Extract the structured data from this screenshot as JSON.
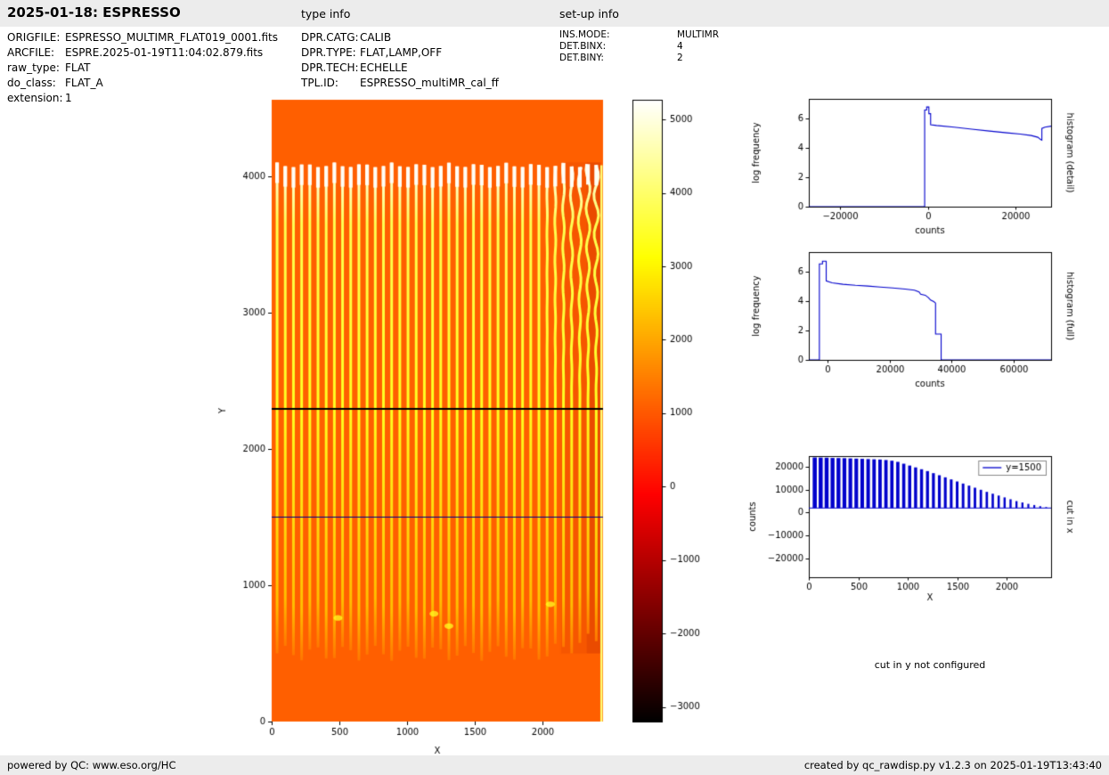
{
  "header": {
    "title": "2025-01-18: ESPRESSO",
    "type_info_label": "type info",
    "setup_info_label": "set-up info"
  },
  "file_info": {
    "rows": [
      {
        "label": "ORIGFILE:",
        "value": "ESPRESSO_MULTIMR_FLAT019_0001.fits"
      },
      {
        "label": "ARCFILE:",
        "value": "ESPRE.2025-01-19T11:04:02.879.fits"
      },
      {
        "label": "raw_type:",
        "value": "FLAT"
      },
      {
        "label": "do_class:",
        "value": "FLAT_A"
      },
      {
        "label": "extension:",
        "value": "1"
      }
    ]
  },
  "type_info": {
    "rows": [
      {
        "label": "DPR.CATG:",
        "value": "CALIB"
      },
      {
        "label": "DPR.TYPE:",
        "value": "FLAT,LAMP,OFF"
      },
      {
        "label": "DPR.TECH:",
        "value": "ECHELLE"
      },
      {
        "label": "TPL.ID:",
        "value": "ESPRESSO_multiMR_cal_ff"
      }
    ]
  },
  "setup_info": {
    "rows": [
      {
        "label": "INS.MODE:",
        "value": "MULTIMR"
      },
      {
        "label": "DET.BINX:",
        "value": "4"
      },
      {
        "label": "DET.BINY:",
        "value": "2"
      }
    ]
  },
  "cut_y_note": "cut in y not configured",
  "footer": {
    "left": "powered by QC: www.eso.org/HC",
    "right": "created by qc_rawdisp.py v1.2.3 on 2025-01-19T13:43:40"
  },
  "colors": {
    "plot_line": "#0000cc",
    "cut_line": "#00008b",
    "bar_bg": "#ececec"
  },
  "chart_data": [
    {
      "id": "raw_image",
      "type": "heatmap",
      "xlabel": "X",
      "ylabel": "Y",
      "xlim": [
        0,
        2450
      ],
      "ylim": [
        0,
        4560
      ],
      "xticks": [
        0,
        500,
        1000,
        1500,
        2000
      ],
      "yticks": [
        0,
        1000,
        2000,
        3000,
        4000
      ],
      "colormap": "hot",
      "background_value": 1100,
      "stripes": {
        "count": 40,
        "x_first": 40,
        "x_step": 60.5,
        "y_bottom": 500,
        "y_top": 4100,
        "value": 3400,
        "tip_value": 5200
      },
      "black_line_y": 2300,
      "cut_line_y": 1500,
      "cut_line_color": "#00008b",
      "edge_line": {
        "x": 2438,
        "value": 4100,
        "y0": 0,
        "y1": 4080
      },
      "dark_bands": [
        {
          "x0": 2140,
          "x1": 2430,
          "y0": 500,
          "y1": 4100,
          "alpha": 0.12
        },
        {
          "x0": 2330,
          "x1": 2434,
          "y0": 500,
          "y1": 4100,
          "alpha": 0.18
        }
      ],
      "blobs": [
        [
          1200,
          790
        ],
        [
          1310,
          700
        ],
        [
          490,
          760
        ],
        [
          2060,
          860
        ]
      ],
      "colorbar": {
        "vmin": -3200,
        "vmax": 5270,
        "ticks": [
          5000,
          4000,
          3000,
          2000,
          1000,
          0,
          -1000,
          -2000,
          -3000
        ]
      }
    },
    {
      "id": "histogram_detail",
      "type": "line",
      "side_label": "histogram (detail)",
      "xlabel": "counts",
      "ylabel": "log frequency",
      "xlim": [
        -27000,
        28000
      ],
      "ylim": [
        0,
        7.3
      ],
      "xticks": [
        -20000,
        0,
        20000
      ],
      "yticks": [
        0,
        2,
        4,
        6
      ],
      "color": "#0000cc",
      "points": [
        [
          -27000,
          0
        ],
        [
          -700,
          0
        ],
        [
          -700,
          6.55
        ],
        [
          -250,
          6.55
        ],
        [
          -250,
          6.75
        ],
        [
          250,
          6.75
        ],
        [
          250,
          6.3
        ],
        [
          650,
          6.3
        ],
        [
          650,
          5.55
        ],
        [
          2000,
          5.5
        ],
        [
          6000,
          5.38
        ],
        [
          10000,
          5.25
        ],
        [
          14000,
          5.12
        ],
        [
          18000,
          5.0
        ],
        [
          21000,
          4.92
        ],
        [
          23500,
          4.82
        ],
        [
          25000,
          4.7
        ],
        [
          25600,
          4.55
        ],
        [
          25900,
          4.5
        ],
        [
          25900,
          5.3
        ],
        [
          26600,
          5.38
        ],
        [
          28000,
          5.45
        ]
      ]
    },
    {
      "id": "histogram_full",
      "type": "line",
      "side_label": "histogram (full)",
      "xlabel": "counts",
      "ylabel": "log frequency",
      "xlim": [
        -6000,
        72000
      ],
      "ylim": [
        0,
        7.3
      ],
      "xticks": [
        0,
        20000,
        40000,
        60000
      ],
      "yticks": [
        0,
        2,
        4,
        6
      ],
      "color": "#0000cc",
      "points": [
        [
          -6000,
          0
        ],
        [
          -2600,
          0
        ],
        [
          -2600,
          6.5
        ],
        [
          -1600,
          6.5
        ],
        [
          -1600,
          6.68
        ],
        [
          -400,
          6.68
        ],
        [
          -400,
          5.35
        ],
        [
          1500,
          5.22
        ],
        [
          5000,
          5.12
        ],
        [
          9000,
          5.05
        ],
        [
          13000,
          5.0
        ],
        [
          17000,
          4.93
        ],
        [
          21000,
          4.87
        ],
        [
          25000,
          4.8
        ],
        [
          28000,
          4.72
        ],
        [
          29500,
          4.6
        ],
        [
          30000,
          4.45
        ],
        [
          31500,
          4.38
        ],
        [
          32500,
          4.22
        ],
        [
          33200,
          4.05
        ],
        [
          34200,
          3.95
        ],
        [
          34800,
          3.85
        ],
        [
          34800,
          1.75
        ],
        [
          36600,
          1.75
        ],
        [
          36600,
          0
        ],
        [
          72000,
          0
        ]
      ]
    },
    {
      "id": "cut_in_x",
      "type": "line",
      "side_label": "cut in x",
      "legend_label": "y=1500",
      "xlabel": "X",
      "ylabel": "counts",
      "xlim": [
        0,
        2450
      ],
      "ylim": [
        -28000,
        24500
      ],
      "xticks": [
        0,
        500,
        1000,
        1500,
        2000
      ],
      "yticks": [
        -20000,
        -10000,
        0,
        10000,
        20000
      ],
      "color": "#0000cc",
      "baseline": 2000,
      "spikes": [
        [
          60,
          23900
        ],
        [
          120,
          23850
        ],
        [
          180,
          23800
        ],
        [
          240,
          23700
        ],
        [
          300,
          23650
        ],
        [
          360,
          23600
        ],
        [
          420,
          23500
        ],
        [
          480,
          23400
        ],
        [
          540,
          23300
        ],
        [
          600,
          23200
        ],
        [
          660,
          23100
        ],
        [
          720,
          23000
        ],
        [
          780,
          22800
        ],
        [
          840,
          22500
        ],
        [
          900,
          22000
        ],
        [
          960,
          21200
        ],
        [
          1020,
          20400
        ],
        [
          1080,
          19600
        ],
        [
          1140,
          18800
        ],
        [
          1200,
          18000
        ],
        [
          1260,
          17100
        ],
        [
          1320,
          16200
        ],
        [
          1380,
          15300
        ],
        [
          1440,
          14400
        ],
        [
          1500,
          13500
        ],
        [
          1560,
          12600
        ],
        [
          1620,
          11700
        ],
        [
          1680,
          10800
        ],
        [
          1740,
          9900
        ],
        [
          1800,
          9000
        ],
        [
          1860,
          8200
        ],
        [
          1920,
          7400
        ],
        [
          1980,
          6600
        ],
        [
          2040,
          5800
        ],
        [
          2100,
          5000
        ],
        [
          2160,
          4400
        ],
        [
          2220,
          3800
        ],
        [
          2280,
          3300
        ],
        [
          2340,
          2800
        ],
        [
          2400,
          2400
        ]
      ]
    }
  ]
}
